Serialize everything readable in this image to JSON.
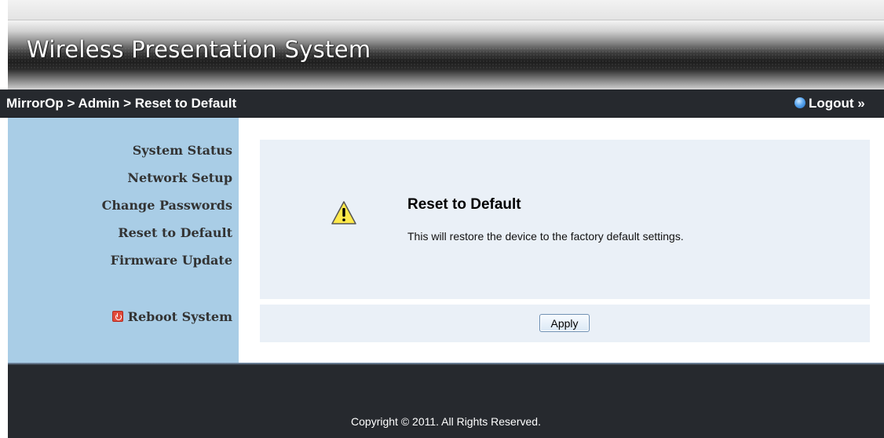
{
  "header": {
    "title": "Wireless Presentation System"
  },
  "navbar": {
    "breadcrumb": "MirrorOp > Admin > Reset to Default",
    "logout_label": "Logout »"
  },
  "sidebar": {
    "items": [
      {
        "label": "System Status"
      },
      {
        "label": "Network Setup"
      },
      {
        "label": "Change Passwords"
      },
      {
        "label": "Reset to Default"
      },
      {
        "label": "Firmware Update"
      }
    ],
    "reboot_label": "Reboot System"
  },
  "main": {
    "title": "Reset to Default",
    "description": "This will restore the device to the factory default settings.",
    "apply_label": "Apply"
  },
  "footer": {
    "copyright": "Copyright © 2011. All Rights Reserved."
  },
  "colors": {
    "sidebar_bg": "#a9cde6",
    "nav_bg": "#26292e",
    "panel_bg": "#eaf0f7"
  },
  "icons": {
    "logout": "globe-icon",
    "reboot": "power-icon",
    "warning": "warning-icon"
  }
}
